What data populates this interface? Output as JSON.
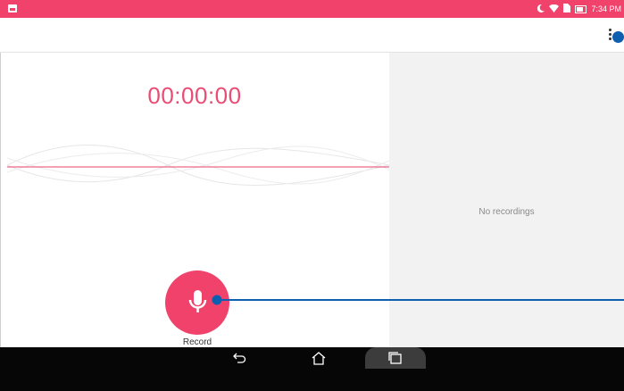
{
  "status": {
    "time": "7:34 PM"
  },
  "recorder": {
    "timer": "00:00:00",
    "record_label": "Record"
  },
  "recordings": {
    "empty_text": "No recordings"
  },
  "icons": {
    "status_left": "screenshot-icon",
    "moon": "moon-icon",
    "wifi": "wifi-icon",
    "sim": "sim-icon",
    "battery": "battery-icon",
    "overflow": "overflow-menu-icon",
    "mic": "microphone-icon",
    "back": "back-icon",
    "home": "home-icon",
    "recent": "recent-apps-icon"
  },
  "colors": {
    "accent": "#f0426b",
    "timer": "#ea4d73",
    "pointer": "#0f5fb0"
  }
}
